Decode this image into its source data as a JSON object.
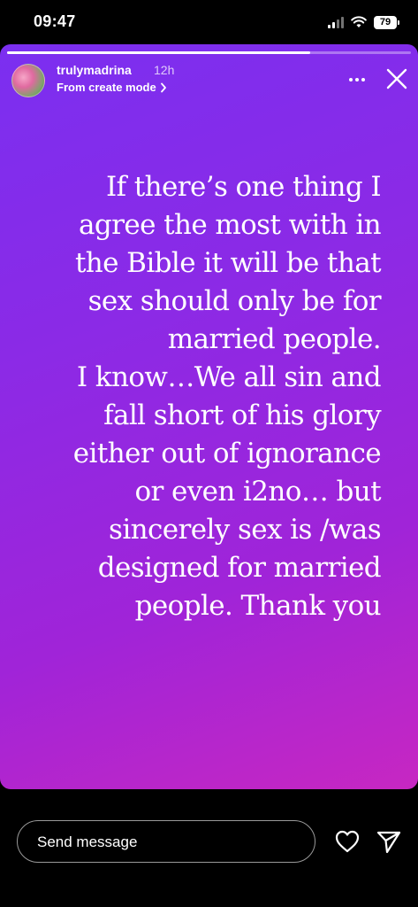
{
  "status_bar": {
    "time": "09:47",
    "battery": "79",
    "icons": [
      "signal-icon",
      "wifi-icon",
      "battery-icon"
    ]
  },
  "story": {
    "progress": 0.75,
    "username": "trulymadrina",
    "time_ago": "12h",
    "subtitle": "From create mode",
    "text": "If there’s one thing I\nagree the most with in\nthe Bible it will be that\nsex should only be for\nmarried people.\nI know…We all sin and\nfall short of his glory\neither out of ignorance\nor even i2no… but\nsincerely sex is /was\ndesigned for married\npeople. Thank you",
    "background_colors": [
      "#7b2ff0",
      "#c727c2"
    ]
  },
  "composer": {
    "placeholder": "Send message",
    "icons": [
      "heart-icon",
      "send-icon"
    ]
  }
}
